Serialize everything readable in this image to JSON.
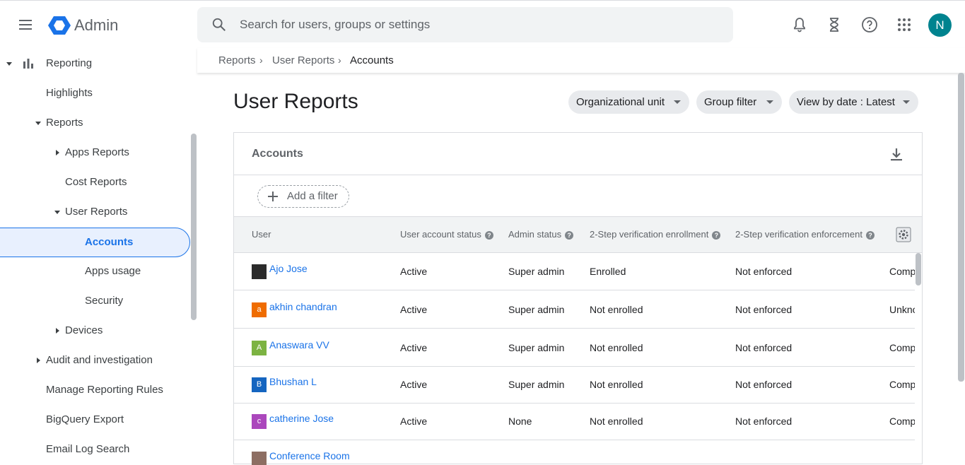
{
  "app": {
    "name": "Admin",
    "user_initial": "N",
    "avatar_color": "#00838f",
    "accent": "#1a73e8"
  },
  "search": {
    "placeholder": "Search for users, groups or settings"
  },
  "sidebar": {
    "reporting": "Reporting",
    "highlights": "Highlights",
    "reports": "Reports",
    "apps_reports": "Apps Reports",
    "cost_reports": "Cost Reports",
    "user_reports": "User Reports",
    "accounts": "Accounts",
    "apps_usage": "Apps usage",
    "security": "Security",
    "devices": "Devices",
    "audit": "Audit and investigation",
    "manage_rules": "Manage Reporting Rules",
    "bigquery": "BigQuery Export",
    "email_log": "Email Log Search"
  },
  "breadcrumb": {
    "reports": "Reports",
    "user_reports": "User Reports",
    "accounts": "Accounts"
  },
  "page": {
    "title": "User Reports",
    "filters": {
      "org_unit": "Organizational unit",
      "group": "Group filter",
      "date": "View by date : Latest"
    }
  },
  "card": {
    "title": "Accounts",
    "add_filter": "Add a filter",
    "columns": [
      "User",
      "User account status",
      "Admin status",
      "2-Step verification enrollment",
      "2-Step verification enforcement"
    ],
    "rows": [
      {
        "initial": "",
        "color": "#2b2b2b",
        "user": "Ajo Jose",
        "status": "Active",
        "admin": "Super admin",
        "enrollment": "Enrolled",
        "enforcement": "Not enforced",
        "extra": "Comp"
      },
      {
        "initial": "a",
        "color": "#ef6c00",
        "user": "akhin chandran",
        "status": "Active",
        "admin": "Super admin",
        "enrollment": "Not enrolled",
        "enforcement": "Not enforced",
        "extra": "Unkno"
      },
      {
        "initial": "A",
        "color": "#7cb342",
        "user": "Anaswara VV",
        "status": "Active",
        "admin": "Super admin",
        "enrollment": "Not enrolled",
        "enforcement": "Not enforced",
        "extra": "Comp"
      },
      {
        "initial": "B",
        "color": "#1565c0",
        "user": "Bhushan L",
        "status": "Active",
        "admin": "Super admin",
        "enrollment": "Not enrolled",
        "enforcement": "Not enforced",
        "extra": "Comp"
      },
      {
        "initial": "c",
        "color": "#ab47bc",
        "user": "catherine Jose",
        "status": "Active",
        "admin": "None",
        "enrollment": "Not enrolled",
        "enforcement": "Not enforced",
        "extra": "Comp"
      },
      {
        "initial": "",
        "color": "#8d6e63",
        "user": "Conference Room",
        "status": "",
        "admin": "",
        "enrollment": "",
        "enforcement": "",
        "extra": ""
      }
    ]
  }
}
